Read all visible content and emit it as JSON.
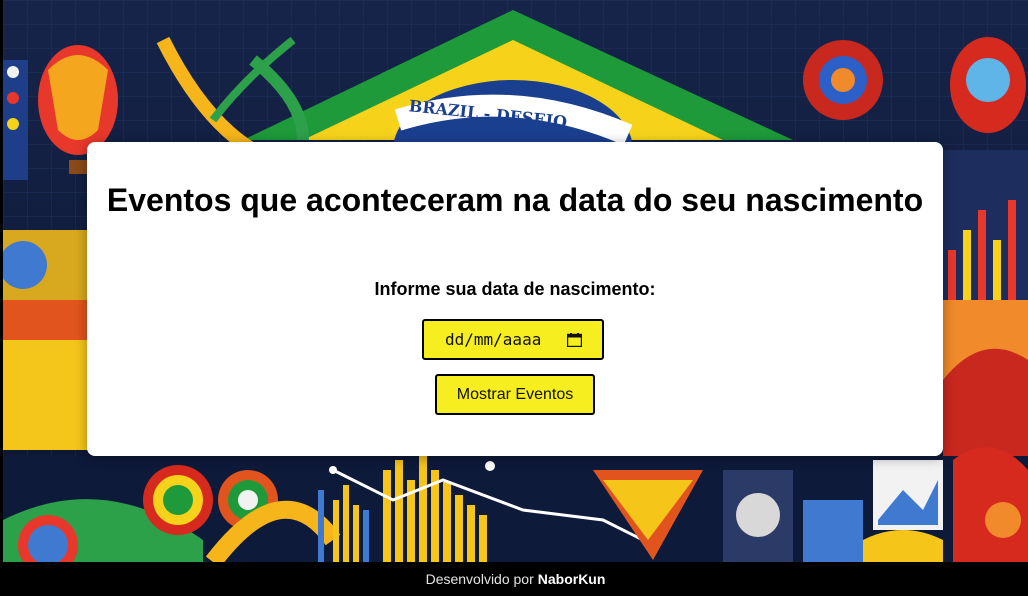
{
  "background": {
    "banner_text": "BRAZIL - DESEJO",
    "colors": {
      "green": "#1e9a3a",
      "yellow": "#f6d31a",
      "blue": "#1b3f8f",
      "red": "#d62a1e",
      "dark": "#0e1a3a"
    }
  },
  "main": {
    "title": "Eventos que aconteceram na data do seu nascimento",
    "date_label": "Informe sua data de nascimento:",
    "date_input": {
      "value": "",
      "placeholder": "dd/mm/aaaa",
      "icon": "calendar-icon"
    },
    "show_button_label": "Mostrar Eventos"
  },
  "footer": {
    "prefix": "Desenvolvido por",
    "author": "NaborKun"
  },
  "theme": {
    "accent": "#f7ee1f",
    "card_bg": "#ffffff",
    "footer_bg": "#000000"
  }
}
